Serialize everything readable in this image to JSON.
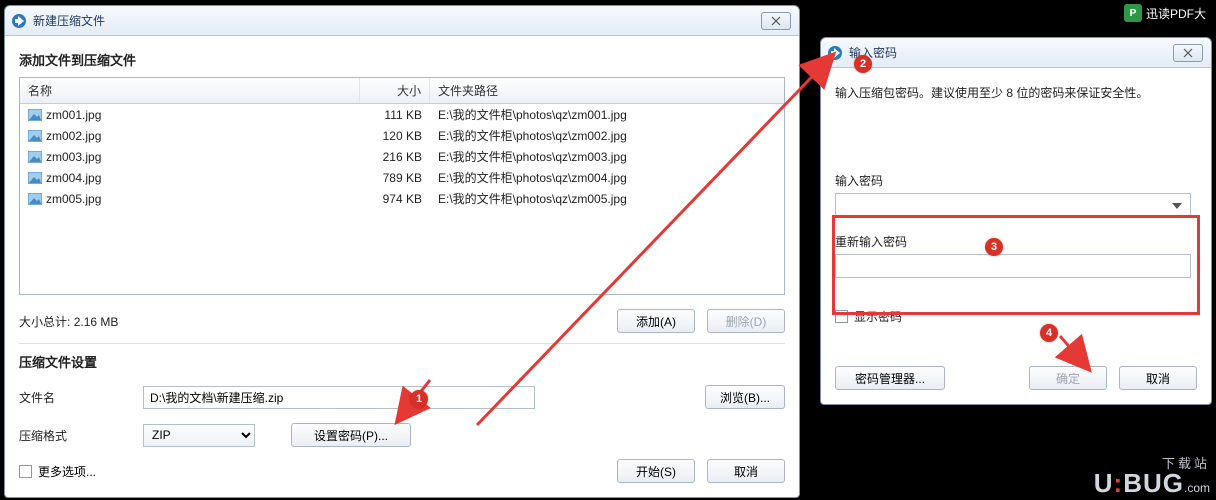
{
  "taskbar": {
    "item_label": "迅读PDF大"
  },
  "dialog1": {
    "title": "新建压缩文件",
    "heading": "添加文件到压缩文件",
    "columns": {
      "name": "名称",
      "size": "大小",
      "path": "文件夹路径"
    },
    "files": [
      {
        "name": "zm001.jpg",
        "size": "111 KB",
        "path": "E:\\我的文件柜\\photos\\qz\\zm001.jpg"
      },
      {
        "name": "zm002.jpg",
        "size": "120 KB",
        "path": "E:\\我的文件柜\\photos\\qz\\zm002.jpg"
      },
      {
        "name": "zm003.jpg",
        "size": "216 KB",
        "path": "E:\\我的文件柜\\photos\\qz\\zm003.jpg"
      },
      {
        "name": "zm004.jpg",
        "size": "789 KB",
        "path": "E:\\我的文件柜\\photos\\qz\\zm004.jpg"
      },
      {
        "name": "zm005.jpg",
        "size": "974 KB",
        "path": "E:\\我的文件柜\\photos\\qz\\zm005.jpg"
      }
    ],
    "total_label": "大小总计:",
    "total_value": "2.16 MB",
    "add_btn": "添加(A)",
    "delete_btn": "删除(D)",
    "settings_heading": "压缩文件设置",
    "filename_label": "文件名",
    "filename_value": "D:\\我的文档\\新建压缩.zip",
    "browse_btn": "浏览(B)...",
    "format_label": "压缩格式",
    "format_value": "ZIP",
    "set_password_btn": "设置密码(P)...",
    "more_options_label": "更多选项...",
    "start_btn": "开始(S)",
    "cancel_btn": "取消"
  },
  "dialog2": {
    "title": "输入密码",
    "msg": "输入压缩包密码。建议使用至少 8 位的密码来保证安全性。",
    "input_label": "输入密码",
    "reinput_label": "重新输入密码",
    "show_pw_label": "显示密码",
    "pw_manager_btn": "密码管理器...",
    "ok_btn": "确定",
    "cancel_btn": "取消"
  },
  "annotations": {
    "marker1": "1",
    "marker2": "2",
    "marker3": "3",
    "marker4": "4"
  },
  "watermark": {
    "line1": "下载站",
    "brand": "UBUG",
    "suffix": ".com"
  }
}
